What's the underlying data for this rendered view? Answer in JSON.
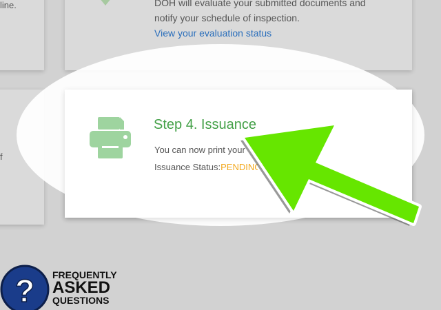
{
  "top_section": {
    "left_fragment": "line.",
    "description_line1": "DOH will evaluate your submitted documents and",
    "description_line2": "notify your schedule of inspection.",
    "link": "View your evaluation status"
  },
  "left_fragment_mid": "f",
  "step4": {
    "title": "Step 4. Issuance",
    "description": "You can now print your",
    "status_label": "Issuance Status:",
    "status_value": "PENDING"
  },
  "faq": {
    "line1": "FREQUENTLY",
    "line2": "ASKED",
    "line3": "QUESTIONS"
  },
  "colors": {
    "accent_green": "#43a047",
    "status_orange": "#f2a81d",
    "link_blue": "#2a6ebb",
    "arrow_green": "#66e600"
  }
}
